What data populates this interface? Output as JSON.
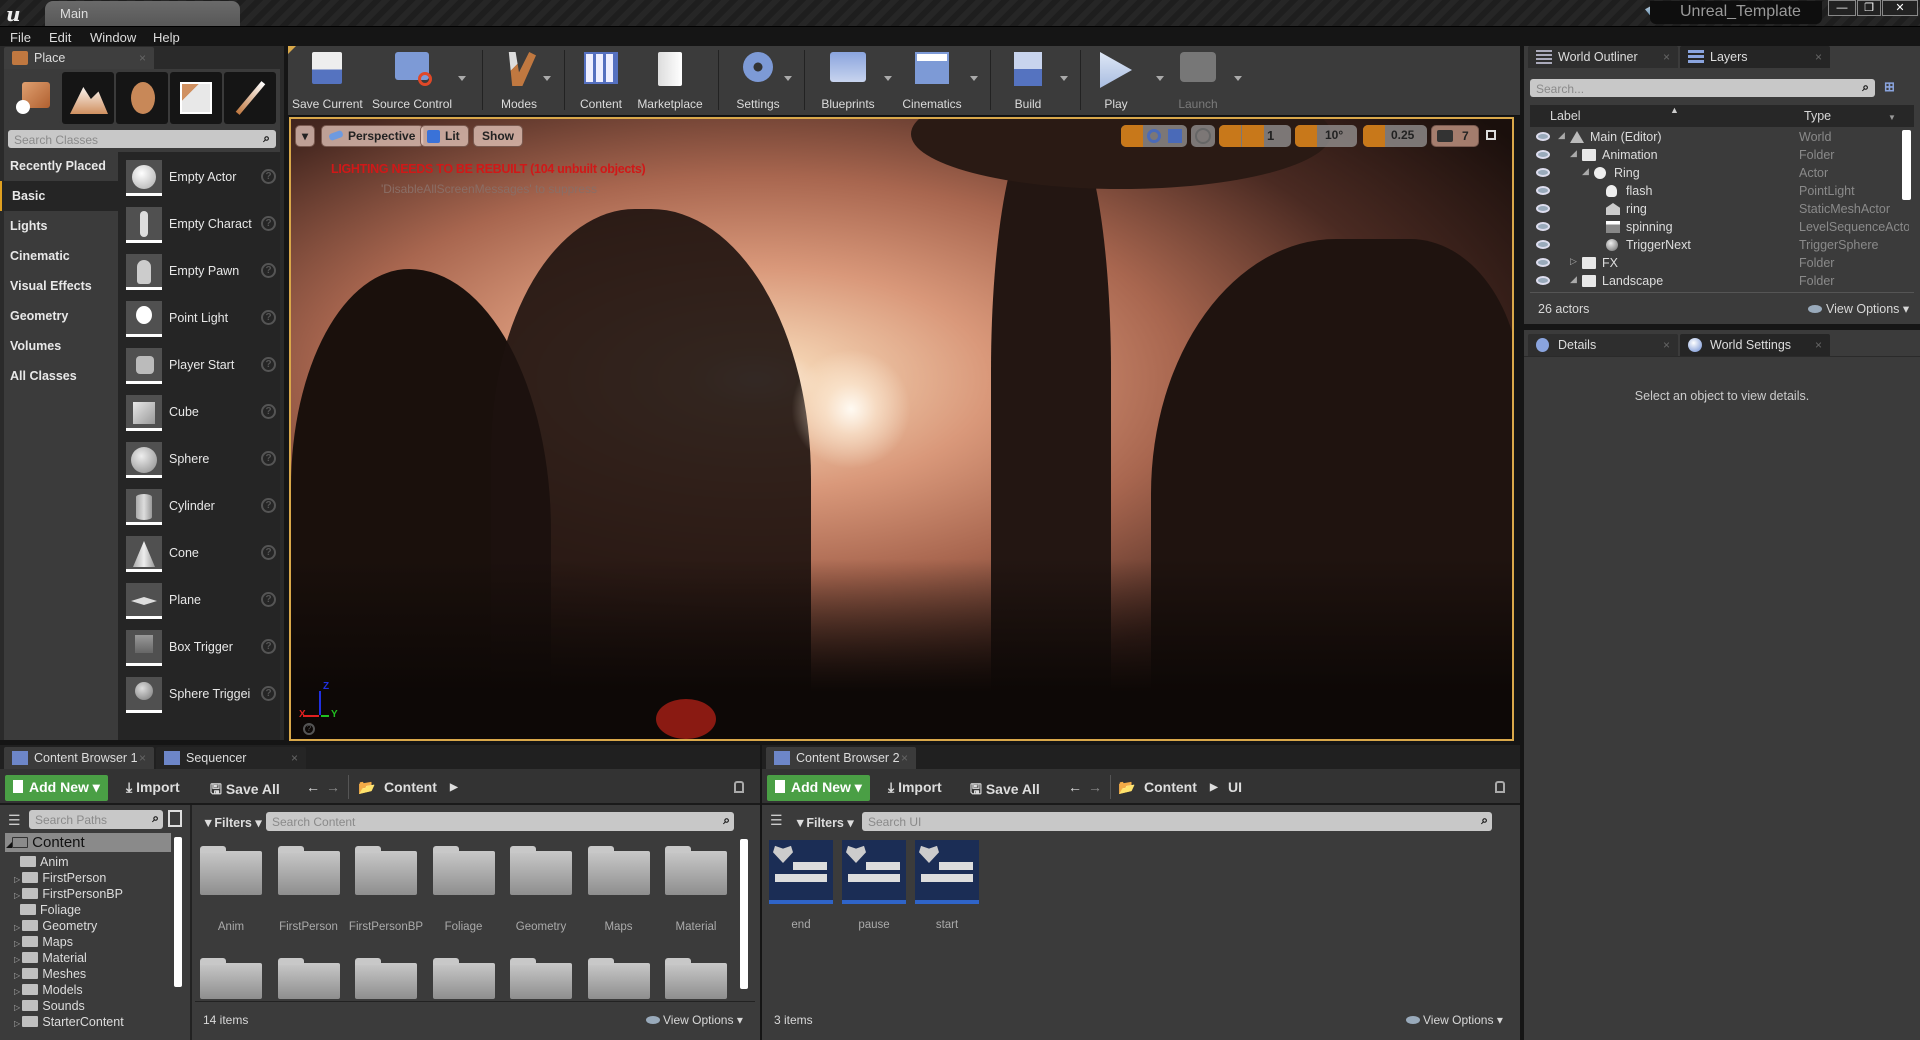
{
  "window": {
    "tab_title": "Main",
    "project_name": "Unreal_Template",
    "controls": {
      "minimize": "—",
      "restore": "❐",
      "close": "✕"
    }
  },
  "menu": [
    "File",
    "Edit",
    "Window",
    "Help"
  ],
  "place_panel": {
    "tab_label": "Place",
    "modes": [
      "place-mode-icon",
      "landscape-mode-icon",
      "foliage-mode-icon",
      "geometry-mode-icon",
      "paint-mode-icon"
    ],
    "search_placeholder": "Search Classes",
    "categories": [
      "Recently Placed",
      "Basic",
      "Lights",
      "Cinematic",
      "Visual Effects",
      "Geometry",
      "Volumes",
      "All Classes"
    ],
    "active_category": "Basic",
    "items": [
      "Empty Actor",
      "Empty Charact",
      "Empty Pawn",
      "Point Light",
      "Player Start",
      "Cube",
      "Sphere",
      "Cylinder",
      "Cone",
      "Plane",
      "Box Trigger",
      "Sphere Triggei"
    ]
  },
  "toolbar": {
    "buttons": [
      {
        "label": "Save Current",
        "icon": "floppy-disk-icon"
      },
      {
        "label": "Source Control",
        "icon": "source-control-icon"
      },
      {
        "label": "Modes",
        "icon": "modes-tools-icon"
      },
      {
        "label": "Content",
        "icon": "content-grid-icon"
      },
      {
        "label": "Marketplace",
        "icon": "marketplace-bag-icon"
      },
      {
        "label": "Settings",
        "icon": "settings-gear-icon"
      },
      {
        "label": "Blueprints",
        "icon": "blueprints-gamepad-icon"
      },
      {
        "label": "Cinematics",
        "icon": "clapperboard-icon"
      },
      {
        "label": "Build",
        "icon": "build-blocks-icon"
      },
      {
        "label": "Play",
        "icon": "play-icon"
      },
      {
        "label": "Launch",
        "icon": "launch-icon"
      }
    ]
  },
  "viewport": {
    "view_mode": "Perspective",
    "lighting_mode": "Lit",
    "show_label": "Show",
    "grid_snap": "1",
    "rotation_snap": "10°",
    "scale_snap": "0.25",
    "camera_speed": "7",
    "warning": "LIGHTING NEEDS TO BE REBUILT (104 unbuilt objects)",
    "suppress_msg": "'DisableAllScreenMessages' to suppress",
    "axis": {
      "x": "X",
      "y": "Y",
      "z": "Z"
    },
    "accent": "#d9a84a"
  },
  "outliner": {
    "tabs": [
      "World Outliner",
      "Layers"
    ],
    "search_placeholder": "Search...",
    "columns": [
      "Label",
      "Type"
    ],
    "rows": [
      {
        "label": "Main (Editor)",
        "type": "World"
      },
      {
        "label": "Animation",
        "type": "Folder"
      },
      {
        "label": "Ring",
        "type": "Actor"
      },
      {
        "label": "flash",
        "type": "PointLight"
      },
      {
        "label": "ring",
        "type": "StaticMeshActor"
      },
      {
        "label": "spinning",
        "type": "LevelSequenceActo"
      },
      {
        "label": "TriggerNext",
        "type": "TriggerSphere"
      },
      {
        "label": "FX",
        "type": "Folder"
      },
      {
        "label": "Landscape",
        "type": "Folder"
      }
    ],
    "count": "26 actors",
    "view_options": "View Options"
  },
  "details": {
    "tabs": [
      "Details",
      "World Settings"
    ],
    "empty_msg": "Select an object to view details."
  },
  "content_browser_1": {
    "tabs": [
      "Content Browser 1",
      "Sequencer"
    ],
    "add_new": "Add New",
    "import": "Import",
    "save_all": "Save All",
    "path": [
      "Content"
    ],
    "search_paths_placeholder": "Search Paths",
    "filters": "Filters",
    "search_placeholder": "Search Content",
    "tree": [
      "Content",
      "Anim",
      "FirstPerson",
      "FirstPersonBP",
      "Foliage",
      "Geometry",
      "Maps",
      "Material",
      "Meshes",
      "Models",
      "Sounds",
      "StarterContent"
    ],
    "folders": [
      "Anim",
      "FirstPerson",
      "FirstPersonBP",
      "Foliage",
      "Geometry",
      "Maps",
      "Material"
    ],
    "count": "14 items",
    "view_options": "View Options"
  },
  "content_browser_2": {
    "tabs": [
      "Content Browser 2"
    ],
    "add_new": "Add New",
    "import": "Import",
    "save_all": "Save All",
    "path": [
      "Content",
      "UI"
    ],
    "filters": "Filters",
    "search_placeholder": "Search UI",
    "assets": [
      "end",
      "pause",
      "start"
    ],
    "count": "3 items",
    "view_options": "View Options",
    "accent": "#4a9f45"
  }
}
